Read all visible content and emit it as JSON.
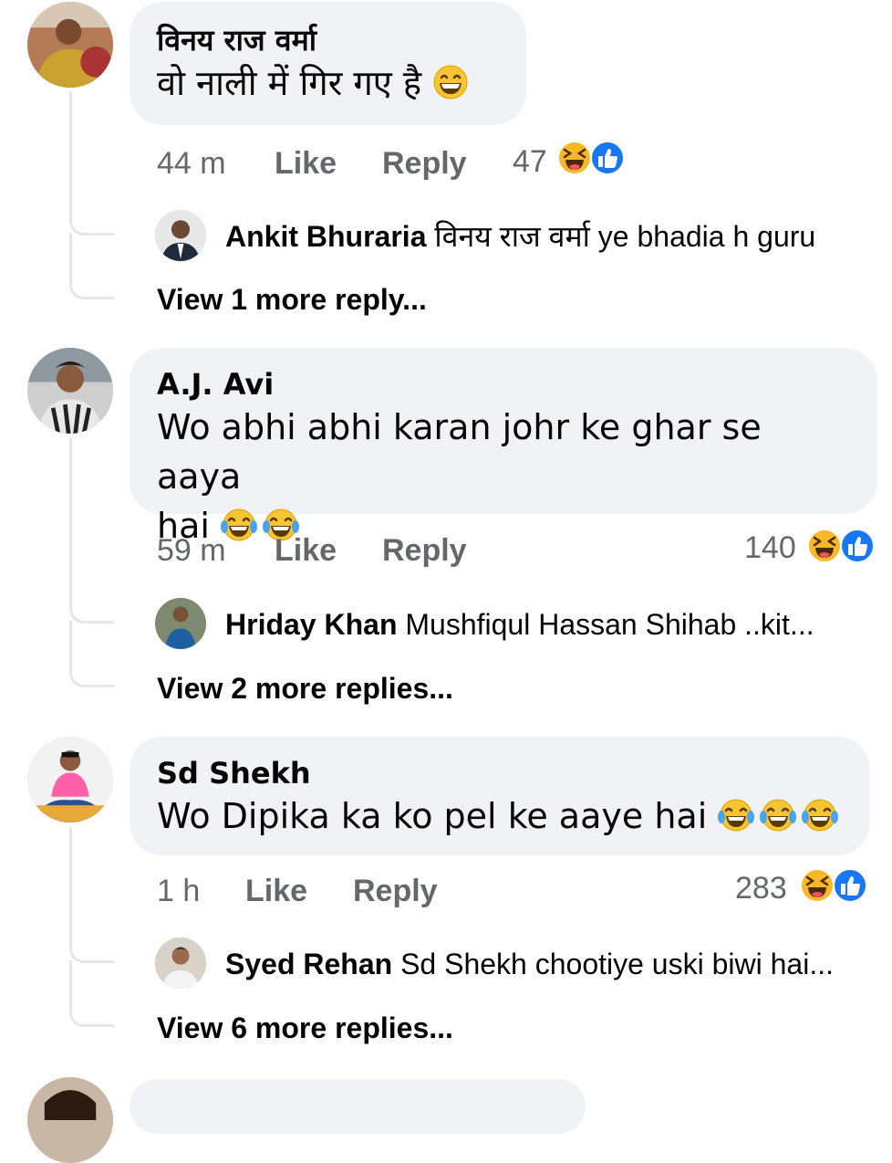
{
  "comments": [
    {
      "author": "विनय राज वर्मा",
      "text": "वो नाली में गिर गए है",
      "emoji": [
        "grinning-face"
      ],
      "time": "44 m",
      "like_label": "Like",
      "reply_label": "Reply",
      "reaction_count": "47",
      "reactions": [
        "haha-icon",
        "like-icon"
      ],
      "reply": {
        "author": "Ankit Bhuraria",
        "text": "विनय राज वर्मा ye bhadia h guru"
      },
      "more_replies": "View 1 more reply..."
    },
    {
      "author": "A.J. Avi",
      "text_line1": "Wo abhi abhi karan johr ke ghar se aaya",
      "text_line2": "hai",
      "emoji": [
        "tears-of-joy-face",
        "tears-of-joy-face"
      ],
      "time": "59 m",
      "like_label": "Like",
      "reply_label": "Reply",
      "reaction_count": "140",
      "reactions": [
        "haha-icon",
        "like-icon"
      ],
      "reply": {
        "author": "Hriday Khan",
        "text": "Mushfiqul Hassan Shihab  ..kit..."
      },
      "more_replies": "View 2 more replies..."
    },
    {
      "author": "Sd Shekh",
      "text": "Wo Dipika ka ko pel ke aaye hai",
      "emoji": [
        "tears-of-joy-face",
        "tears-of-joy-face",
        "tears-of-joy-face"
      ],
      "time": "1 h",
      "like_label": "Like",
      "reply_label": "Reply",
      "reaction_count": "283",
      "reactions": [
        "haha-icon",
        "like-icon"
      ],
      "reply": {
        "author": "Syed Rehan",
        "text": "Sd Shekh chootiye uski biwi hai..."
      },
      "more_replies": "View 6 more replies..."
    }
  ],
  "colors": {
    "bubble": "#f0f2f5",
    "meta": "#65676b",
    "like_blue": "#1877f2",
    "haha_yellow": "#f7b928"
  }
}
